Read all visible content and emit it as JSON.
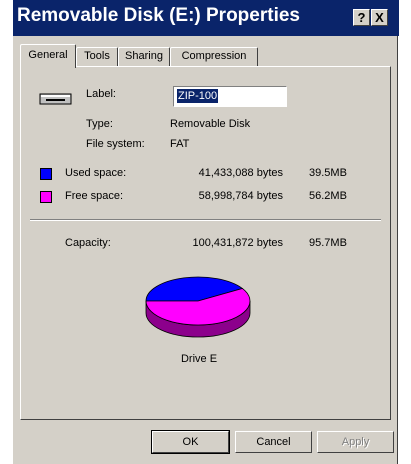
{
  "window": {
    "title": "Removable Disk (E:) Properties",
    "help_button": "?",
    "close_button": "X"
  },
  "tabs": [
    {
      "label": "General",
      "active": true
    },
    {
      "label": "Tools"
    },
    {
      "label": "Sharing"
    },
    {
      "label": "Compression"
    }
  ],
  "general": {
    "label_caption": "Label:",
    "label_value": "ZIP-100",
    "type_caption": "Type:",
    "type_value": "Removable Disk",
    "filesystem_caption": "File system:",
    "filesystem_value": "FAT",
    "used": {
      "caption": "Used space:",
      "bytes": "41,433,088 bytes",
      "size": "39.5MB",
      "color": "#0000ff"
    },
    "free": {
      "caption": "Free space:",
      "bytes": "58,998,784 bytes",
      "size": "56.2MB",
      "color": "#ff00ff"
    },
    "capacity": {
      "caption": "Capacity:",
      "bytes": "100,431,872 bytes",
      "size": "95.7MB"
    },
    "drive_caption": "Drive E",
    "drive_icon": "removable-drive-icon"
  },
  "chart_data": {
    "type": "pie",
    "categories": [
      "Used space",
      "Free space"
    ],
    "values": [
      41433088,
      58998784
    ],
    "colors": [
      "#0000ff",
      "#ff00ff"
    ]
  },
  "buttons": {
    "ok": "OK",
    "cancel": "Cancel",
    "apply": "Apply"
  }
}
